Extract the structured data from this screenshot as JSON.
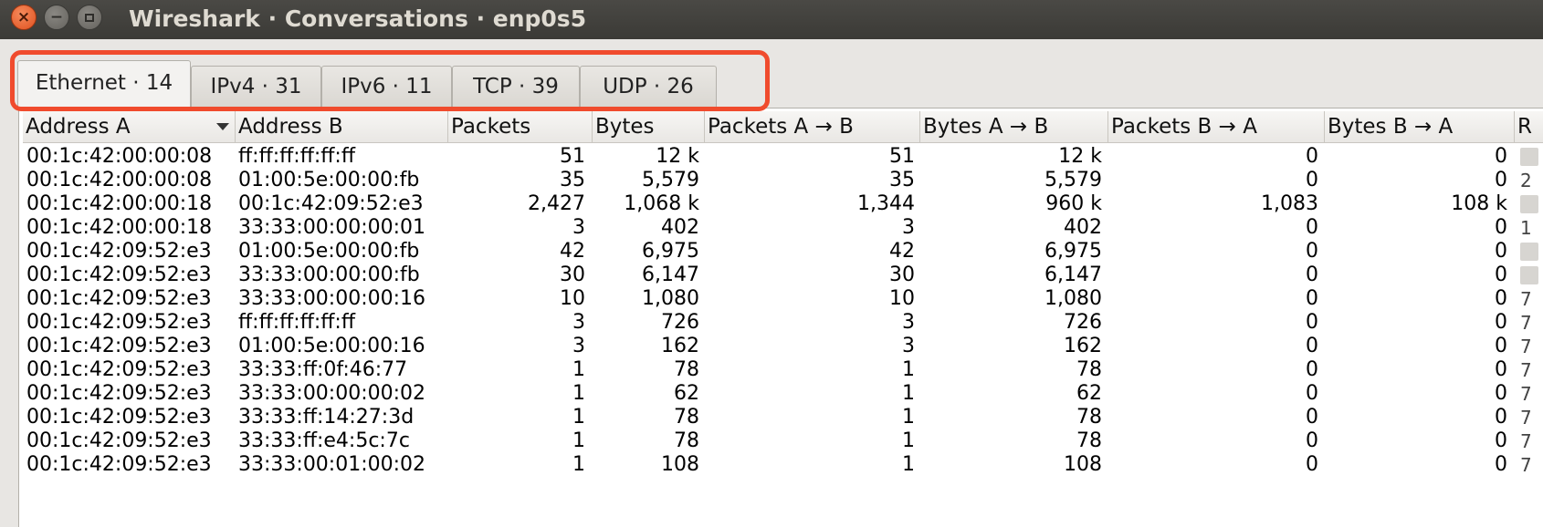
{
  "window": {
    "title": "Wireshark · Conversations · enp0s5",
    "buttons": {
      "close": "×",
      "minimize": "−"
    }
  },
  "tabs": [
    {
      "label": "Ethernet · 14",
      "active": true
    },
    {
      "label": "IPv4 · 31",
      "active": false
    },
    {
      "label": "IPv6 · 11",
      "active": false
    },
    {
      "label": "TCP · 39",
      "active": false
    },
    {
      "label": "UDP · 26",
      "active": false
    }
  ],
  "table": {
    "columns": [
      "Address A",
      "Address B",
      "Packets",
      "Bytes",
      "Packets A → B",
      "Bytes A → B",
      "Packets B → A",
      "Bytes B → A",
      "R"
    ],
    "sorted_column": "Address A",
    "rows": [
      [
        "00:1c:42:00:00:08",
        "ff:ff:ff:ff:ff:ff",
        "51",
        "12 k",
        "51",
        "12 k",
        "0",
        "0"
      ],
      [
        "00:1c:42:00:00:08",
        "01:00:5e:00:00:fb",
        "35",
        "5,579",
        "35",
        "5,579",
        "0",
        "0"
      ],
      [
        "00:1c:42:00:00:18",
        "00:1c:42:09:52:e3",
        "2,427",
        "1,068 k",
        "1,344",
        "960 k",
        "1,083",
        "108 k"
      ],
      [
        "00:1c:42:00:00:18",
        "33:33:00:00:00:01",
        "3",
        "402",
        "3",
        "402",
        "0",
        "0"
      ],
      [
        "00:1c:42:09:52:e3",
        "01:00:5e:00:00:fb",
        "42",
        "6,975",
        "42",
        "6,975",
        "0",
        "0"
      ],
      [
        "00:1c:42:09:52:e3",
        "33:33:00:00:00:fb",
        "30",
        "6,147",
        "30",
        "6,147",
        "0",
        "0"
      ],
      [
        "00:1c:42:09:52:e3",
        "33:33:00:00:00:16",
        "10",
        "1,080",
        "10",
        "1,080",
        "0",
        "0"
      ],
      [
        "00:1c:42:09:52:e3",
        "ff:ff:ff:ff:ff:ff",
        "3",
        "726",
        "3",
        "726",
        "0",
        "0"
      ],
      [
        "00:1c:42:09:52:e3",
        "01:00:5e:00:00:16",
        "3",
        "162",
        "3",
        "162",
        "0",
        "0"
      ],
      [
        "00:1c:42:09:52:e3",
        "33:33:ff:0f:46:77",
        "1",
        "78",
        "1",
        "78",
        "0",
        "0"
      ],
      [
        "00:1c:42:09:52:e3",
        "33:33:00:00:00:02",
        "1",
        "62",
        "1",
        "62",
        "0",
        "0"
      ],
      [
        "00:1c:42:09:52:e3",
        "33:33:ff:14:27:3d",
        "1",
        "78",
        "1",
        "78",
        "0",
        "0"
      ],
      [
        "00:1c:42:09:52:e3",
        "33:33:ff:e4:5c:7c",
        "1",
        "78",
        "1",
        "78",
        "0",
        "0"
      ],
      [
        "00:1c:42:09:52:e3",
        "33:33:00:01:00:02",
        "1",
        "108",
        "1",
        "108",
        "0",
        "0"
      ]
    ],
    "partial_rel_start": [
      "bar",
      "2",
      "bar",
      "1",
      "bar",
      "bar",
      "7",
      "7",
      "7",
      "7",
      "7",
      "7",
      "7",
      "7"
    ]
  },
  "colors": {
    "highlight": "#f04b2d",
    "titlebar": "#3b3a36"
  }
}
